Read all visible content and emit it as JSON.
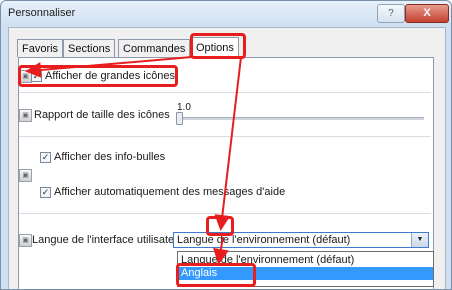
{
  "window": {
    "title": "Personnaliser",
    "help_glyph": "?",
    "close_glyph": "X"
  },
  "tabs": [
    {
      "label": "Favoris"
    },
    {
      "label": "Sections"
    },
    {
      "label": "Commandes"
    },
    {
      "label": "Options",
      "selected": true
    }
  ],
  "options": {
    "large_icons": {
      "label": "Afficher de grandes icônes",
      "checked": true
    },
    "icon_size": {
      "label": "Rapport de taille des icônes",
      "value": "1.0"
    },
    "tooltips": {
      "label": "Afficher des info-bulles",
      "checked": true
    },
    "auto_help": {
      "label": "Afficher automatiquement des messages d'aide",
      "checked": true
    },
    "language": {
      "label": "Langue de l'interface utilisateur",
      "selected_value": "Langue de l'environnement (défaut)",
      "options": [
        "Langue de l'environnement (défaut)",
        "Anglais"
      ],
      "highlighted": "Anglais"
    }
  },
  "colors": {
    "annotation": "#e81e1e",
    "selection": "#3399ff"
  }
}
